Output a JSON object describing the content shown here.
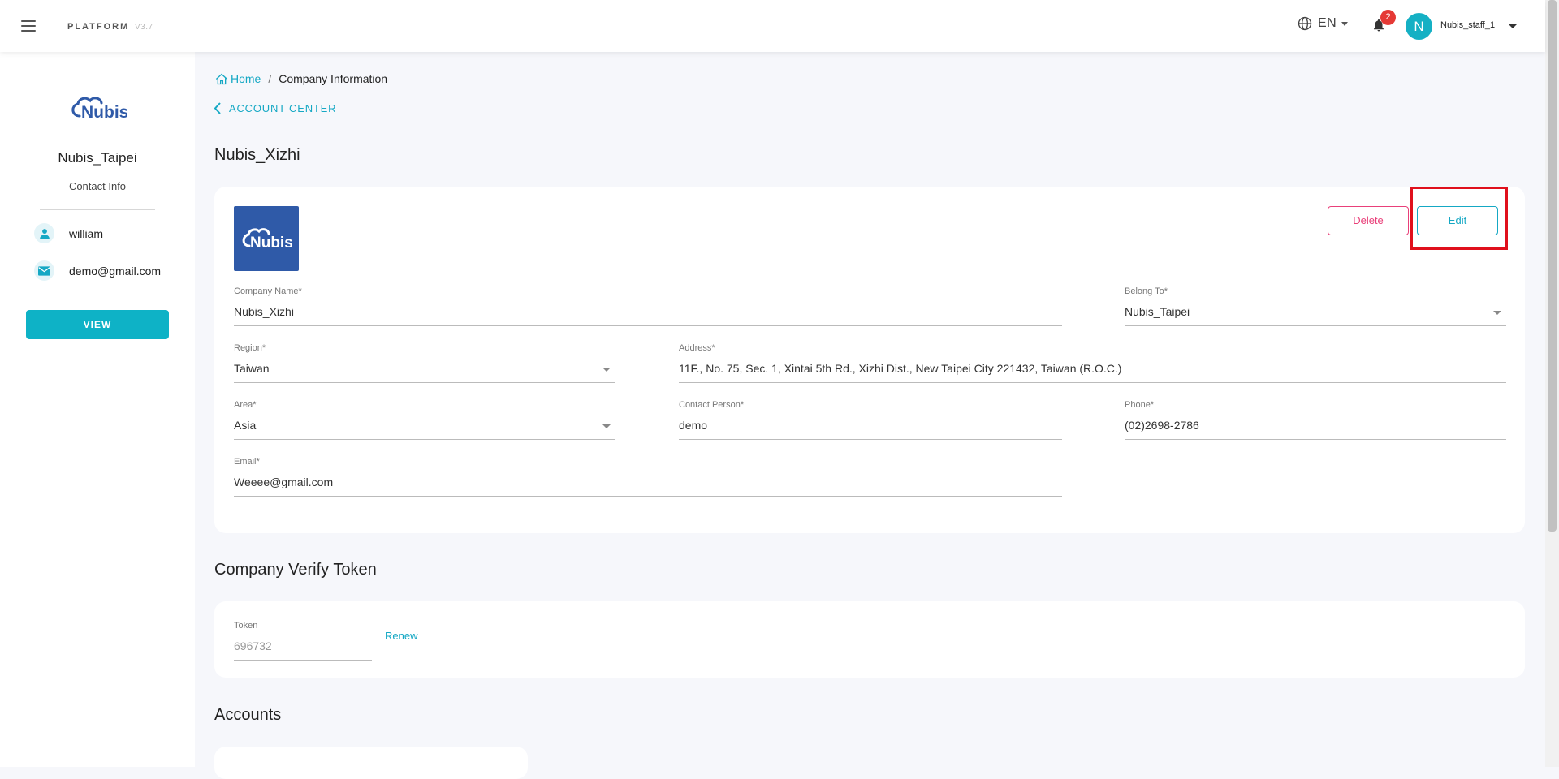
{
  "topbar": {
    "brand": "PLATFORM",
    "version": "V3.7",
    "language": "EN",
    "notification_count": "2",
    "avatar_initial": "N",
    "username": "Nubis_staff_1"
  },
  "sidebar": {
    "logo_text": "Nubis",
    "company": "Nubis_Taipei",
    "contact_label": "Contact Info",
    "contact_name": "william",
    "contact_email": "demo@gmail.com",
    "view_button": "VIEW"
  },
  "breadcrumb": {
    "home": "Home",
    "separator": "/",
    "current": "Company Information"
  },
  "back_link": "ACCOUNT CENTER",
  "page_title": "Nubis_Xizhi",
  "company_card": {
    "logo_text": "Nubis",
    "delete_button": "Delete",
    "edit_button": "Edit",
    "fields": {
      "company_name": {
        "label": "Company Name*",
        "value": "Nubis_Xizhi"
      },
      "belong_to": {
        "label": "Belong To*",
        "value": "Nubis_Taipei"
      },
      "region": {
        "label": "Region*",
        "value": "Taiwan"
      },
      "address": {
        "label": "Address*",
        "value": "11F., No. 75, Sec. 1, Xintai 5th Rd., Xizhi Dist., New Taipei City 221432, Taiwan (R.O.C.)"
      },
      "area": {
        "label": "Area*",
        "value": "Asia"
      },
      "contact_person": {
        "label": "Contact Person*",
        "value": "demo"
      },
      "phone": {
        "label": "Phone*",
        "value": "(02)2698-2786"
      },
      "email": {
        "label": "Email*",
        "value": "Weeee@gmail.com"
      }
    }
  },
  "token_section": {
    "title": "Company Verify Token",
    "token_label": "Token",
    "token_value": "696732",
    "renew_button": "Renew"
  },
  "accounts_section": {
    "title": "Accounts"
  },
  "colors": {
    "accent": "#15a8c4",
    "danger": "#e9407a",
    "highlight": "#e0101c",
    "logo_bg": "#2f5aa8"
  }
}
